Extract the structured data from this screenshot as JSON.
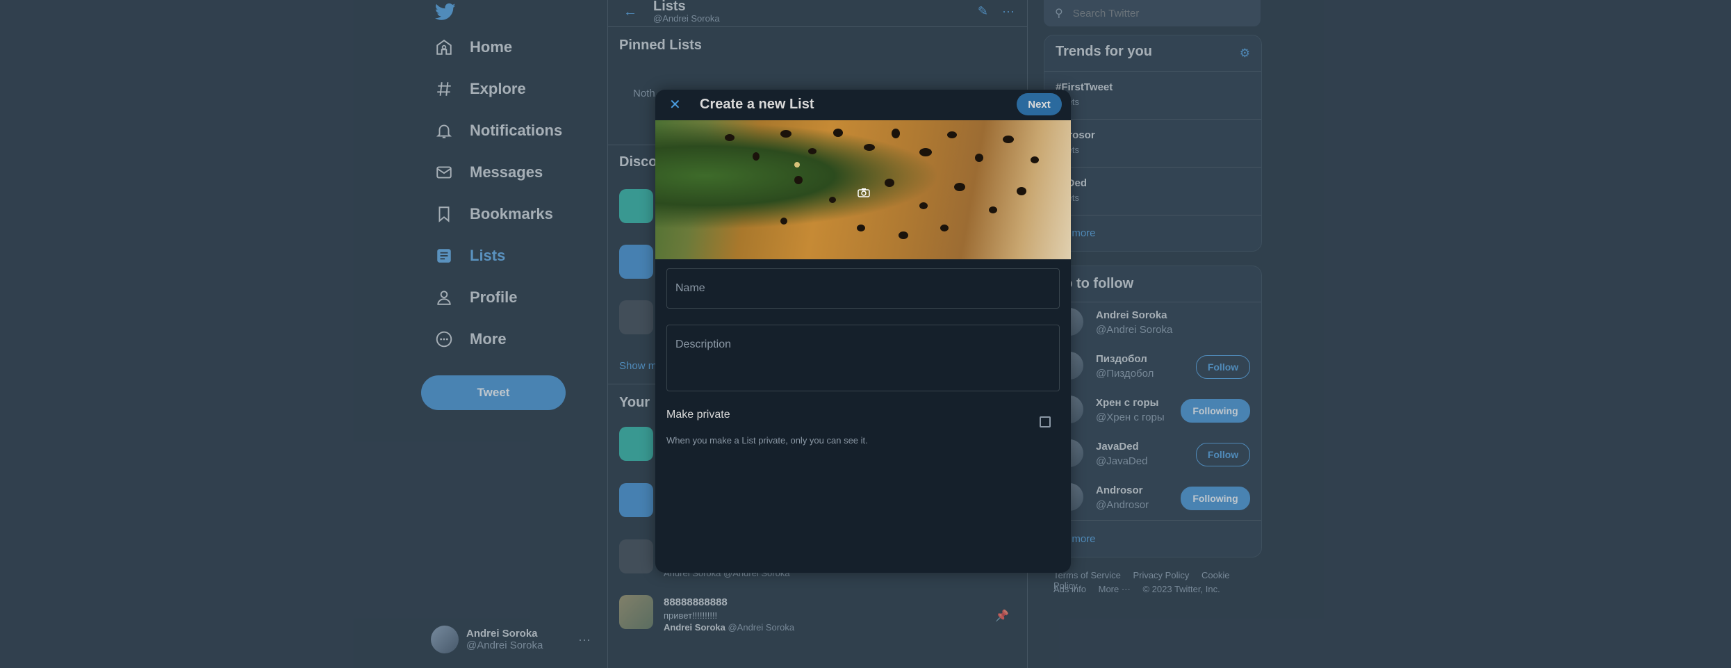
{
  "sidebar": {
    "logo": "twitter-bird-icon",
    "nav": [
      {
        "label": "Home",
        "icon": "home-icon"
      },
      {
        "label": "Explore",
        "icon": "hashtag-icon"
      },
      {
        "label": "Notifications",
        "icon": "bell-icon"
      },
      {
        "label": "Messages",
        "icon": "envelope-icon"
      },
      {
        "label": "Bookmarks",
        "icon": "bookmark-icon"
      },
      {
        "label": "Lists",
        "icon": "list-icon",
        "active": true
      },
      {
        "label": "Profile",
        "icon": "person-icon"
      },
      {
        "label": "More",
        "icon": "more-circle-icon"
      }
    ],
    "tweet_label": "Tweet",
    "account": {
      "name": "Andrei Soroka",
      "handle": "@Andrei Soroka"
    }
  },
  "center": {
    "title": "Lists",
    "subtitle": "@Andrei Soroka",
    "pinned_title": "Pinned Lists",
    "pinned_empty": "Noth",
    "discover_title": "Disco",
    "show_more": "Show m",
    "your_title": "Your",
    "partial_owner": "Andrei Soroka @Andrei Soroka",
    "last_list": {
      "name": "88888888888",
      "desc": "привет!!!!!!!!!!",
      "owner_name": "Andrei Soroka",
      "owner_handle": "@Andrei Soroka"
    }
  },
  "right": {
    "search_placeholder": "Search Twitter",
    "trends_title": "Trends for you",
    "trends": [
      {
        "name": "#FirstTweet",
        "count": "weets"
      },
      {
        "name": "ndrosor",
        "count": "weets"
      },
      {
        "name": "vaDed",
        "count": "weets"
      }
    ],
    "trends_show_more": "ow more",
    "wtf_title": "ho to follow",
    "wtf": [
      {
        "name": "Andrei Soroka",
        "handle": "@Andrei Soroka",
        "button": ""
      },
      {
        "name": "Пиздобол",
        "handle": "@Пиздобол",
        "button": "Follow"
      },
      {
        "name": "Хрен с горы",
        "handle": "@Хрен с горы",
        "button": "Following"
      },
      {
        "name": "JavaDed",
        "handle": "@JavaDed",
        "button": "Follow"
      },
      {
        "name": "Androsor",
        "handle": "@Androsor",
        "button": "Following"
      }
    ],
    "wtf_show_more": "ow more",
    "footer_line1": [
      "Terms of Service",
      "Privacy Policy",
      "Cookie Policy"
    ],
    "footer_line2": [
      "Ads info",
      "More ···",
      "© 2023 Twitter, Inc."
    ]
  },
  "modal": {
    "title": "Create a new List",
    "next_label": "Next",
    "name_placeholder": "Name",
    "description_placeholder": "Description",
    "private_label": "Make private",
    "private_help": "When you make a List private, only you can see it."
  },
  "colors": {
    "background": "#15202b",
    "accent": "#4a9de0",
    "button": "#3f8fd3",
    "border": "#38444d",
    "muted_text": "#8b98a5"
  }
}
